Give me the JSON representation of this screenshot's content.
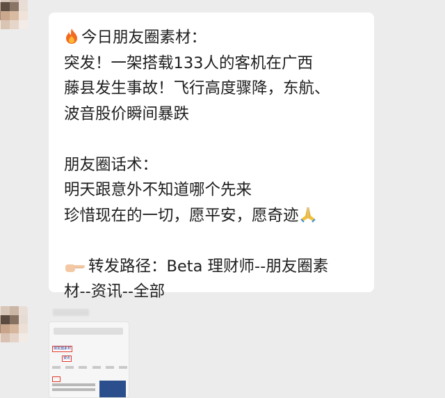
{
  "message": {
    "lines": [
      "今日朋友圈素材：",
      "突发！一架搭载133人的客机在广西",
      "藤县发生事故！飞行高度骤降，东航、",
      "波音股价瞬间暴跌",
      "",
      "朋友圈话术：",
      "明天跟意外不知道哪个先来",
      "珍惜现在的一切，愿平安，愿奇迹",
      "",
      "转发路径：Beta 理财师--朋友圈素",
      "材--资讯--全部"
    ],
    "emojis": {
      "line1": "fire-icon",
      "line8": "praying-hands-icon",
      "line10": "pointing-hand-icon"
    }
  },
  "thumbnail": {
    "chip1": "朋友圈素材",
    "chip2": "资讯"
  },
  "colors": {
    "background": "#ececec",
    "bubble": "#ffffff",
    "text": "#1e1e1e"
  }
}
